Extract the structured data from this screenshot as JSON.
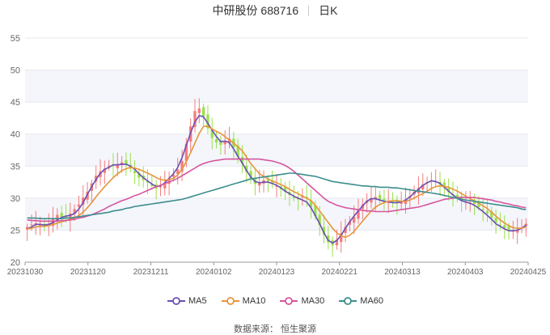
{
  "header": {
    "stock": "中研股份 688716",
    "period": "日K"
  },
  "source": "数据来源： 恒生聚源",
  "colors": {
    "up": "#f47c7c",
    "down": "#9be04c",
    "ma5": "#6a4fb4",
    "ma10": "#e8953b",
    "ma30": "#d6559e",
    "ma60": "#3d8e8e",
    "band": "#f4f6fc"
  },
  "chart_data": {
    "type": "candlestick",
    "ylim": [
      20,
      55
    ],
    "y_ticks": [
      "20",
      "25",
      "30",
      "35",
      "40",
      "45",
      "50",
      "55"
    ],
    "x_tick_labels": [
      "20231030",
      "20231120",
      "20231211",
      "20240102",
      "20240123",
      "20240221",
      "20240313",
      "20240403",
      "20240425"
    ],
    "closes": [
      25.5,
      25.9,
      26.1,
      25.8,
      25.6,
      25.9,
      26.8,
      27.4,
      27.1,
      26.9,
      27.6,
      28.3,
      29.0,
      30.1,
      31.0,
      32.3,
      33.5,
      34.2,
      34.6,
      35.1,
      35.0,
      35.3,
      35.6,
      35.2,
      34.6,
      33.9,
      33.2,
      32.8,
      32.4,
      31.9,
      31.5,
      31.8,
      32.4,
      33.0,
      33.7,
      34.5,
      35.8,
      38.5,
      41.2,
      43.6,
      44.0,
      42.8,
      40.9,
      39.4,
      38.7,
      38.3,
      38.9,
      39.3,
      37.9,
      36.5,
      35.4,
      34.1,
      32.9,
      32.2,
      32.5,
      32.8,
      32.6,
      32.2,
      31.9,
      31.4,
      31.0,
      30.5,
      30.0,
      29.8,
      30.4,
      29.9,
      28.6,
      27.2,
      25.8,
      24.3,
      23.1,
      22.6,
      23.5,
      24.5,
      25.5,
      26.3,
      27.1,
      28.1,
      29.0,
      29.6,
      30.0,
      30.2,
      29.8,
      29.6,
      29.5,
      29.4,
      29.2,
      29.4,
      29.8,
      30.3,
      31.0,
      31.6,
      32.1,
      32.5,
      32.8,
      32.6,
      32.1,
      31.6,
      31.0,
      30.4,
      30.0,
      29.6,
      29.4,
      29.3,
      29.1,
      28.6,
      28.1,
      27.6,
      26.9,
      26.2,
      25.7,
      25.3,
      24.9,
      24.9,
      25.0,
      25.4,
      26.0
    ],
    "series": [
      {
        "name": "MA5",
        "values": [
          25.2,
          25.5,
          25.9,
          25.9,
          25.8,
          25.9,
          26.2,
          26.6,
          27.0,
          27.2,
          27.3,
          27.6,
          28.3,
          29.3,
          30.6,
          31.8,
          32.9,
          33.9,
          34.5,
          34.8,
          35.2,
          35.2,
          35.3,
          35.3,
          35.0,
          34.5,
          33.8,
          33.2,
          32.7,
          32.2,
          31.8,
          31.9,
          32.4,
          33.1,
          33.8,
          34.8,
          36.3,
          38.3,
          40.2,
          41.9,
          42.9,
          42.7,
          41.7,
          40.6,
          39.6,
          38.8,
          38.9,
          38.7,
          37.7,
          36.5,
          35.5,
          34.3,
          33.3,
          32.6,
          32.4,
          32.5,
          32.5,
          32.3,
          32.0,
          31.6,
          31.1,
          30.7,
          30.3,
          30.0,
          29.7,
          29.4,
          28.5,
          27.3,
          26.0,
          24.6,
          23.4,
          23.0,
          23.4,
          24.2,
          25.3,
          26.3,
          27.2,
          28.0,
          28.8,
          29.5,
          29.9,
          29.9,
          29.7,
          29.5,
          29.4,
          29.3,
          29.3,
          29.4,
          29.7,
          30.2,
          30.8,
          31.4,
          32.0,
          32.4,
          32.7,
          32.6,
          32.3,
          31.7,
          31.1,
          30.5,
          30.0,
          29.6,
          29.4,
          29.2,
          28.9,
          28.4,
          27.9,
          27.3,
          26.7,
          26.0,
          25.6,
          25.2,
          24.9,
          24.9,
          25.0,
          25.3,
          25.8
        ]
      },
      {
        "name": "MA10",
        "values": [
          25.2,
          25.3,
          25.5,
          25.6,
          25.6,
          25.7,
          25.9,
          26.1,
          26.3,
          26.5,
          26.7,
          26.9,
          27.3,
          27.8,
          28.5,
          29.3,
          30.2,
          31.0,
          31.8,
          32.5,
          33.2,
          33.8,
          34.3,
          34.6,
          34.8,
          34.7,
          34.5,
          34.2,
          33.9,
          33.6,
          33.2,
          32.9,
          32.8,
          32.9,
          33.1,
          33.6,
          34.5,
          35.7,
          37.1,
          38.6,
          40.1,
          41.2,
          41.2,
          40.8,
          40.4,
          40.1,
          39.6,
          39.1,
          38.6,
          38.0,
          37.4,
          36.4,
          35.4,
          34.6,
          33.8,
          33.4,
          33.0,
          32.7,
          32.4,
          32.1,
          31.8,
          31.4,
          31.0,
          30.7,
          30.3,
          30.0,
          29.6,
          28.9,
          28.0,
          27.1,
          26.2,
          25.3,
          24.6,
          24.1,
          23.9,
          24.2,
          24.8,
          25.6,
          26.4,
          27.2,
          28.0,
          28.6,
          29.0,
          29.3,
          29.5,
          29.6,
          29.6,
          29.5,
          29.5,
          29.7,
          30.0,
          30.4,
          30.7,
          31.1,
          31.5,
          31.8,
          31.9,
          31.8,
          31.7,
          31.4,
          31.1,
          30.7,
          30.3,
          29.9,
          29.6,
          29.2,
          28.8,
          28.4,
          27.8,
          27.2,
          26.6,
          26.1,
          25.7,
          25.4,
          25.3,
          25.3,
          25.5
        ]
      },
      {
        "name": "MA30",
        "values": [
          26.6,
          26.5,
          26.5,
          26.4,
          26.4,
          26.4,
          26.4,
          26.4,
          26.5,
          26.5,
          26.6,
          26.7,
          26.9,
          27.0,
          27.2,
          27.4,
          27.7,
          28.0,
          28.3,
          28.7,
          29.0,
          29.3,
          29.6,
          29.8,
          30.1,
          30.4,
          30.6,
          30.9,
          31.2,
          31.5,
          31.8,
          32.0,
          32.3,
          32.5,
          32.8,
          33.1,
          33.5,
          33.9,
          34.3,
          34.7,
          35.1,
          35.4,
          35.6,
          35.8,
          35.9,
          36.0,
          36.1,
          36.1,
          36.1,
          36.1,
          36.1,
          36.1,
          36.1,
          36.1,
          36.1,
          36.0,
          35.9,
          35.8,
          35.6,
          35.4,
          35.1,
          34.7,
          34.2,
          33.6,
          33.0,
          32.4,
          31.8,
          31.2,
          30.6,
          30.0,
          29.5,
          29.2,
          28.9,
          28.7,
          28.5,
          28.4,
          28.3,
          28.2,
          28.1,
          28.0,
          28.0,
          27.9,
          27.9,
          27.9,
          27.9,
          28.0,
          28.1,
          28.2,
          28.3,
          28.4,
          28.5,
          28.6,
          28.8,
          29.0,
          29.2,
          29.4,
          29.6,
          29.8,
          29.9,
          30.0,
          30.1,
          30.1,
          30.1,
          30.1,
          30.1,
          30.0,
          29.9,
          29.8,
          29.7,
          29.5,
          29.4,
          29.2,
          29.1,
          28.9,
          28.8,
          28.6,
          28.5
        ]
      },
      {
        "name": "MA60",
        "values": [
          26.9,
          26.9,
          26.9,
          26.8,
          26.8,
          26.8,
          26.8,
          26.8,
          26.8,
          26.9,
          26.9,
          27.0,
          27.1,
          27.2,
          27.3,
          27.4,
          27.5,
          27.6,
          27.7,
          27.8,
          28.0,
          28.1,
          28.2,
          28.4,
          28.5,
          28.7,
          28.8,
          28.9,
          29.0,
          29.1,
          29.2,
          29.3,
          29.4,
          29.5,
          29.6,
          29.7,
          29.8,
          30.0,
          30.2,
          30.4,
          30.6,
          30.8,
          31.0,
          31.2,
          31.4,
          31.6,
          31.8,
          32.0,
          32.2,
          32.4,
          32.6,
          32.8,
          33.0,
          33.1,
          33.2,
          33.3,
          33.4,
          33.5,
          33.6,
          33.7,
          33.8,
          33.9,
          33.9,
          33.8,
          33.7,
          33.6,
          33.5,
          33.4,
          33.2,
          33.0,
          32.8,
          32.6,
          32.5,
          32.4,
          32.3,
          32.2,
          32.1,
          32.0,
          31.9,
          31.9,
          31.8,
          31.8,
          31.7,
          31.7,
          31.7,
          31.6,
          31.6,
          31.5,
          31.4,
          31.3,
          31.2,
          31.1,
          31.0,
          30.9,
          30.8,
          30.7,
          30.6,
          30.4,
          30.3,
          30.1,
          30.0,
          29.8,
          29.7,
          29.6,
          29.5,
          29.4,
          29.3,
          29.2,
          29.1,
          29.0,
          28.9,
          28.8,
          28.7,
          28.6,
          28.5,
          28.3,
          28.2
        ]
      }
    ]
  }
}
